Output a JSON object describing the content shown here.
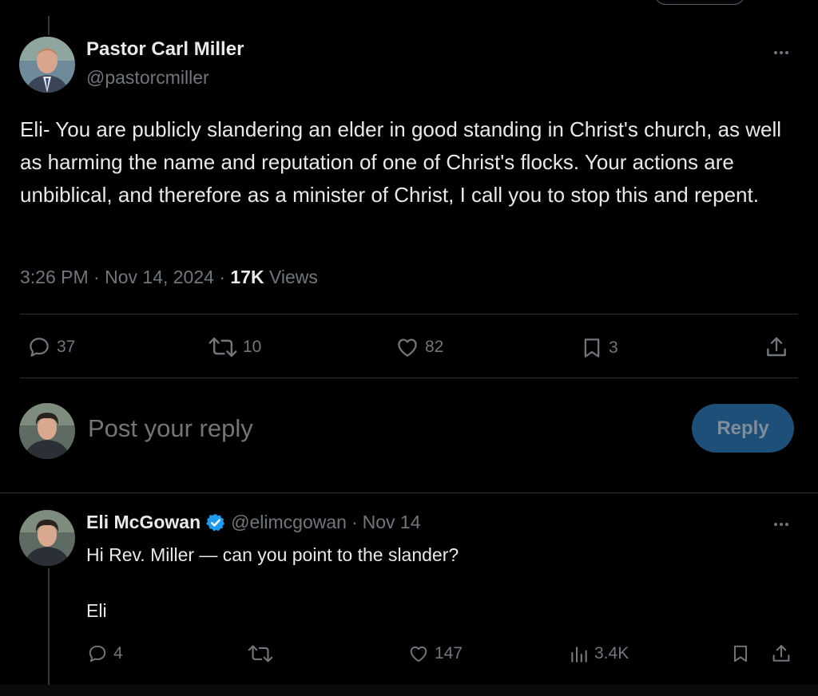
{
  "tweet": {
    "author_name": "Pastor Carl Miller",
    "author_handle": "@pastorcmiller",
    "text": "Eli- You are publicly slandering an elder in good standing in Christ's church, as well as harming the name and reputation of one of Christ's flocks. Your actions are unbiblical, and therefore as a minister of Christ, I call you to stop this and repent.",
    "time": "3:26 PM",
    "date": "Nov 14, 2024",
    "views_count": "17K",
    "views_label": "Views",
    "replies": "37",
    "reposts": "10",
    "likes": "82",
    "bookmarks": "3"
  },
  "composer": {
    "placeholder": "Post your reply",
    "button_label": "Reply"
  },
  "reply": {
    "author_name": "Eli McGowan",
    "author_handle": "@elimcgowan",
    "date": "Nov 14",
    "line1": "Hi Rev. Miller — can you point to the slander?",
    "line2": "Eli",
    "replies": "4",
    "reposts": "",
    "likes": "147",
    "views": "3.4K"
  },
  "colors": {
    "background": "#000000",
    "text_primary": "#e7e9ea",
    "text_secondary": "#71767b",
    "divider": "#2f3336",
    "verified_badge": "#1d9bf0",
    "reply_button": "#1d4f78"
  },
  "icons": [
    "reply-icon",
    "repost-icon",
    "like-icon",
    "bookmark-icon",
    "share-icon",
    "views-icon",
    "more-icon",
    "verified-icon"
  ]
}
